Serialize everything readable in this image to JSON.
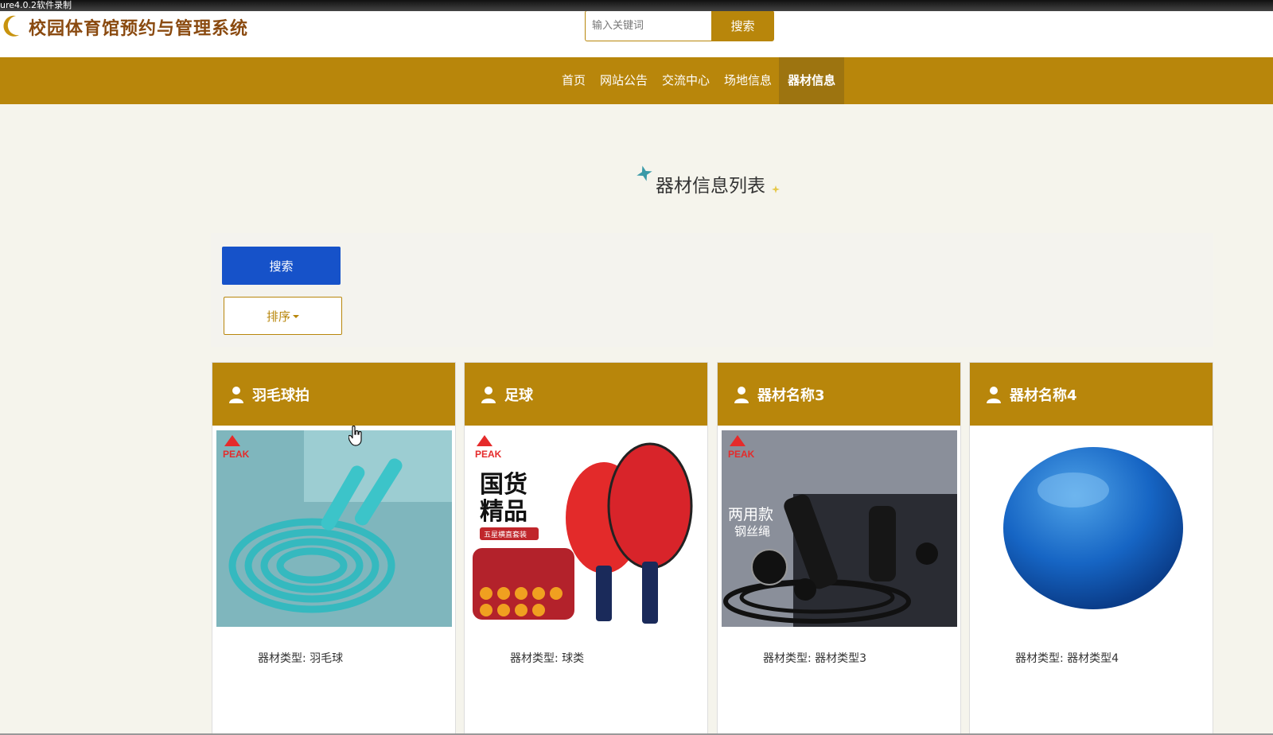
{
  "recorder": {
    "label": "ure4.0.2软件录制"
  },
  "header": {
    "site_title": "校园体育馆预约与管理系统",
    "search_placeholder": "输入关键词",
    "search_button": "搜索"
  },
  "nav": {
    "items": [
      {
        "label": "首页"
      },
      {
        "label": "网站公告"
      },
      {
        "label": "交流中心"
      },
      {
        "label": "场地信息"
      },
      {
        "label": "器材信息"
      }
    ],
    "active_index": 4
  },
  "section": {
    "title": "器材信息列表"
  },
  "filters": {
    "search_button": "搜索",
    "sort_button": "排序"
  },
  "cards": [
    {
      "name": "羽毛球拍",
      "type_label": "器材类型:",
      "type_value": "羽毛球",
      "image": "jump-rope"
    },
    {
      "name": "足球",
      "type_label": "器材类型:",
      "type_value": "球类",
      "image": "ping-pong-set"
    },
    {
      "name": "器材名称3",
      "type_label": "器材类型:",
      "type_value": "器材类型3",
      "image": "steel-jump-rope"
    },
    {
      "name": "器材名称4",
      "type_label": "器材类型:",
      "type_value": "器材类型4",
      "image": "yoga-ball"
    }
  ],
  "image_text": {
    "brand": "PEAK",
    "pingpong_line1": "国货",
    "pingpong_line2": "精品",
    "pingpong_tag": "五星横直套装",
    "rope_line1": "两用款",
    "rope_line2": "钢丝绳"
  },
  "colors": {
    "brand_gold": "#b8860b",
    "nav_active": "#9d7410",
    "primary_blue": "#1652c9",
    "title_brown": "#8a4a10"
  }
}
